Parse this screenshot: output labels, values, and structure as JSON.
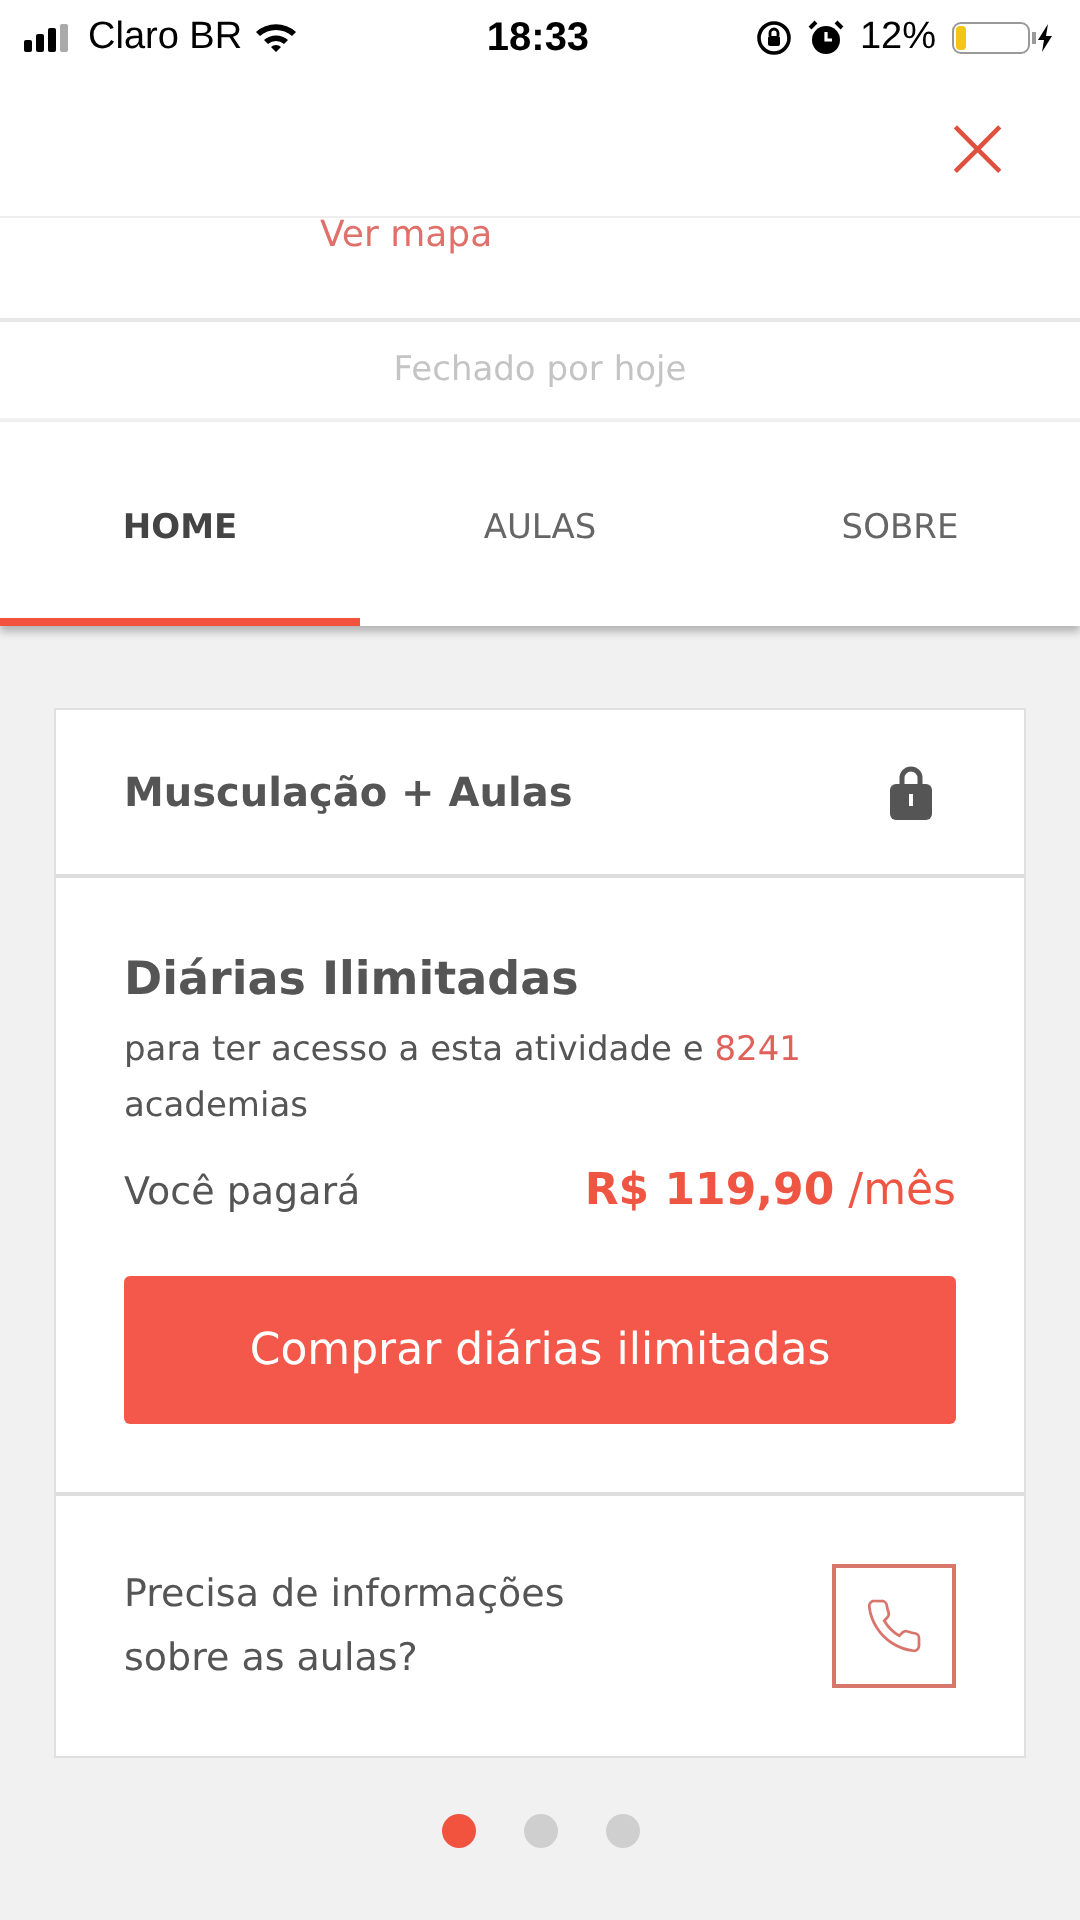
{
  "status_bar": {
    "carrier": "Claro BR",
    "time": "18:33",
    "battery": "12%"
  },
  "header": {
    "close": "×"
  },
  "location": {
    "map_link": "Ver mapa",
    "hours": "Fechado por hoje"
  },
  "tabs": [
    {
      "label": "HOME",
      "selected": true
    },
    {
      "label": "AULAS",
      "selected": false
    },
    {
      "label": "SOBRE",
      "selected": false
    }
  ],
  "card": {
    "title": "Musculação + Aulas",
    "plan": "Diárias Ilimitadas",
    "description_before": "para ter acesso a esta atividade e",
    "gym_count": "8241",
    "description_after": "academias",
    "pay_label": "Você pagará",
    "price": "R$ 119,90",
    "period": "/mês",
    "buy_button": "Comprar diárias ilimitadas",
    "help_text": "Precisa de informações sobre as aulas?"
  },
  "pager": [
    {
      "selected": true
    },
    {
      "selected": false
    },
    {
      "selected": false
    }
  ]
}
